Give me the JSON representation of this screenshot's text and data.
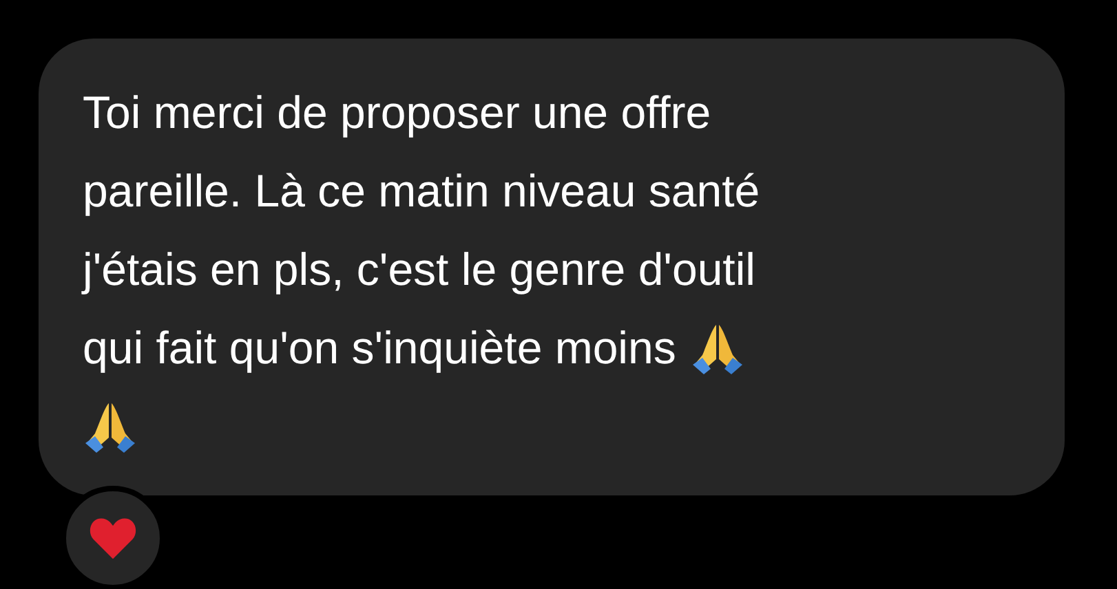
{
  "message": {
    "lines": [
      {
        "text": "Toi merci de proposer une offre",
        "emoji": false
      },
      {
        "text": "pareille. Là ce matin niveau santé",
        "emoji": false
      },
      {
        "text": "j'étais en pls, c'est le genre d'outil",
        "emoji": false
      },
      {
        "text": "qui fait qu'on s'inquiète moins",
        "emoji": true
      },
      {
        "emoji": true
      }
    ],
    "reaction": {
      "kind": "heart"
    }
  }
}
